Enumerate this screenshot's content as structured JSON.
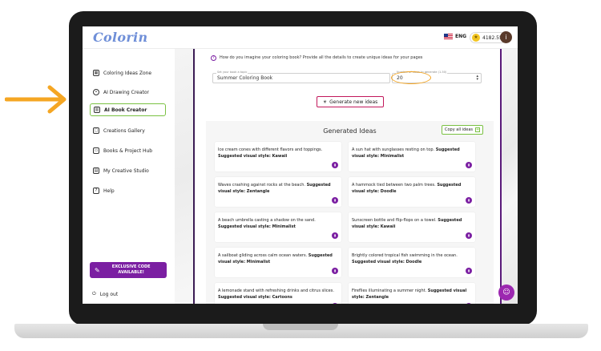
{
  "app": {
    "logo": "Colorin"
  },
  "topbar": {
    "lang": "ENG",
    "credits": "4182.55",
    "avatar_initial": "i"
  },
  "sidebar": {
    "items": [
      {
        "label": "Coloring Ideas Zone",
        "icon": "grid-icon"
      },
      {
        "label": "AI Drawing Creator",
        "icon": "palette-icon"
      },
      {
        "label": "AI Book Creator",
        "icon": "book-icon",
        "active": true
      },
      {
        "label": "Creations Gallery",
        "icon": "gallery-icon"
      },
      {
        "label": "Books & Project Hub",
        "icon": "folder-icon"
      },
      {
        "label": "My Creative Studio",
        "icon": "studio-icon"
      },
      {
        "label": "Help",
        "icon": "help-icon"
      }
    ],
    "promo": "EXCLUSIVE CODE AVAILABLE!",
    "logout": "Log out"
  },
  "form": {
    "question": "How do you imagine your coloring book? Provide all the details to create unique ideas for your pages",
    "theme_label": "Set your book a topic",
    "theme_value": "Summer Coloring Book",
    "count_label": "Number of ideas to generate (1-50)",
    "count_value": "20",
    "generate_label": "Generate new ideas"
  },
  "ideas": {
    "title": "Generated Ideas",
    "copy_label": "Copy all ideas",
    "items": [
      {
        "text": "Ice cream cones with different flavors and toppings.",
        "style": "Suggested visual style: Kawaii"
      },
      {
        "text": "A sun hat with sunglasses resting on top.",
        "style": "Suggested visual style: Minimalist"
      },
      {
        "text": "Waves crashing against rocks at the beach.",
        "style": "Suggested visual style: Zentangle"
      },
      {
        "text": "A hammock tied between two palm trees.",
        "style": "Suggested visual style: Doodle"
      },
      {
        "text": "A beach umbrella casting a shadow on the sand.",
        "style": "Suggested visual style: Minimalist"
      },
      {
        "text": "Sunscreen bottle and flip-flops on a towel.",
        "style": "Suggested visual style: Kawaii"
      },
      {
        "text": "A sailboat gliding across calm ocean waters.",
        "style": "Suggested visual style: Minimalist"
      },
      {
        "text": "Brightly colored tropical fish swimming in the ocean.",
        "style": "Suggested visual style: Doodle"
      },
      {
        "text": "A lemonade stand with refreshing drinks and citrus slices.",
        "style": "Suggested visual style: Cartoons"
      },
      {
        "text": "Fireflies illuminating a summer night.",
        "style": "Suggested visual style: Zentangle"
      }
    ]
  },
  "colors": {
    "accent": "#7b1fa2",
    "active_border": "#7ac142",
    "highlight": "#f5a623",
    "arrow": "#f5a623"
  }
}
